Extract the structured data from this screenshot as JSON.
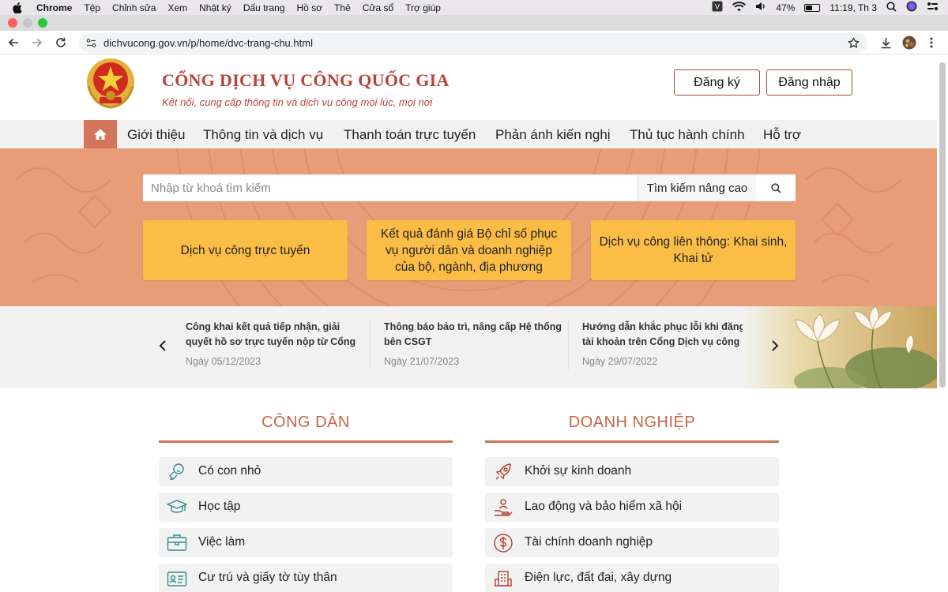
{
  "menubar": {
    "app": "Chrome",
    "items": [
      "Tệp",
      "Chỉnh sửa",
      "Xem",
      "Nhật ký",
      "Dấu trang",
      "Hồ sơ",
      "Thẻ",
      "Cửa sổ",
      "Trợ giúp"
    ],
    "battery_percent": "47%",
    "battery_level": 0.47,
    "clock": "11:19, Th 3"
  },
  "browser": {
    "url": "dichvucong.gov.vn/p/home/dvc-trang-chu.html",
    "window_controls": {
      "close_color": "#ff5f57",
      "minimize_color": "#c7c7c7",
      "zoom_color": "#28c840"
    }
  },
  "header": {
    "title": "CỔNG DỊCH VỤ CÔNG QUỐC GIA",
    "subtitle": "Kết nối, cung cấp thông tin và dịch vụ công mọi lúc, mọi nơi",
    "register_label": "Đăng ký",
    "login_label": "Đăng nhập"
  },
  "nav": {
    "home_icon": "home-icon",
    "items": [
      "Giới thiệu",
      "Thông tin và dịch vụ",
      "Thanh toán trực tuyến",
      "Phản ánh kiến nghị",
      "Thủ tục hành chính",
      "Hỗ trợ"
    ]
  },
  "search": {
    "placeholder": "Nhập từ khoá tìm kiếm",
    "advanced_label": "Tìm kiếm nâng cao"
  },
  "cards": [
    "Dịch vụ công trực tuyến",
    "Kết quả đánh giá Bộ chỉ số phục vụ người dân và doanh nghiệp của bộ, ngành, địa phương",
    "Dịch vụ công liên thông: Khai sinh, Khai tử"
  ],
  "news": [
    {
      "title": "Công khai kết quả tiếp nhận, giải quyết hồ sơ trực tuyến nộp từ Cổng Dịch vụ...",
      "date": "Ngày 05/12/2023"
    },
    {
      "title": "Thông báo bảo trì, nâng cấp Hệ thống bên CSGT",
      "date": "Ngày 21/07/2023"
    },
    {
      "title": "Hướng dẫn khắc phục lỗi khi đăng ký tài khoản trên Cổng Dịch vụ công quốc gia",
      "date": "Ngày 29/07/2022"
    }
  ],
  "citizen": {
    "title": "CÔNG DÂN",
    "items": [
      {
        "label": "Có con nhỏ",
        "icon": "baby-icon"
      },
      {
        "label": "Học tập",
        "icon": "graduation-cap-icon"
      },
      {
        "label": "Việc làm",
        "icon": "briefcase-icon"
      },
      {
        "label": "Cư trú và giấy tờ tùy thân",
        "icon": "id-card-icon"
      }
    ]
  },
  "business": {
    "title": "DOANH NGHIỆP",
    "items": [
      {
        "label": "Khởi sự kinh doanh",
        "icon": "rocket-icon"
      },
      {
        "label": "Lao động và bảo hiểm xã hội",
        "icon": "worker-icon"
      },
      {
        "label": "Tài chính doanh nghiệp",
        "icon": "dollar-icon"
      },
      {
        "label": "Điện lực, đất đai, xây dựng",
        "icon": "building-icon"
      }
    ]
  },
  "colors": {
    "brand_red": "#b8433a",
    "nav_home_bg": "#d3755a",
    "hero_bg": "#e99c78",
    "card_yellow": "#fbbd45",
    "section_title": "#c66645",
    "citizen_icon": "#2f8f89",
    "business_icon": "#b5402f"
  }
}
